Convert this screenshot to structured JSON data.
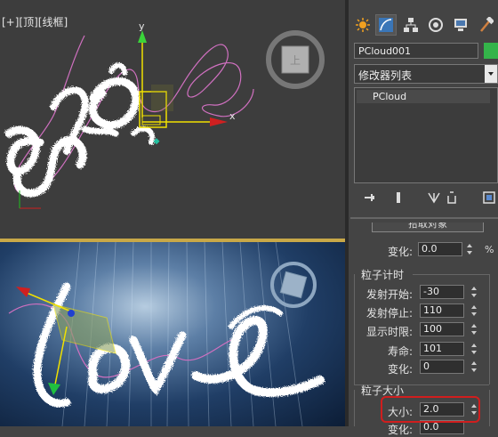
{
  "viewport_top": {
    "label": "[+][顶][线框]",
    "axis_x": "x",
    "axis_y": "y"
  },
  "viewport_bottom": {
    "name": "perspective-viewport"
  },
  "panel": {
    "tabs": [
      {
        "icon": "sun-create-icon"
      },
      {
        "icon": "modify-curve-icon"
      },
      {
        "icon": "hierarchy-icon"
      },
      {
        "icon": "motion-icon"
      },
      {
        "icon": "display-icon"
      },
      {
        "icon": "utilities-hammer-icon"
      }
    ],
    "object_name": "PCloud001",
    "object_color": "#34b44a",
    "modifier_list_label": "修改器列表",
    "stack_item": "PCloud",
    "cut_button_label": "拾取对象",
    "variation_label": "变化:",
    "variation_value": "0.0",
    "variation_unit": "%",
    "timing_group": {
      "title": "粒子计时",
      "fields": [
        {
          "label": "发射开始:",
          "value": "-30"
        },
        {
          "label": "发射停止:",
          "value": "110"
        },
        {
          "label": "显示时限:",
          "value": "100"
        },
        {
          "label": "寿命:",
          "value": "101"
        },
        {
          "label": "变化:",
          "value": "0"
        }
      ]
    },
    "size_group": {
      "title": "粒子大小",
      "size_label": "大小:",
      "size_value": "2.0",
      "variation_label": "变化:",
      "variation_value": "0.0"
    }
  }
}
